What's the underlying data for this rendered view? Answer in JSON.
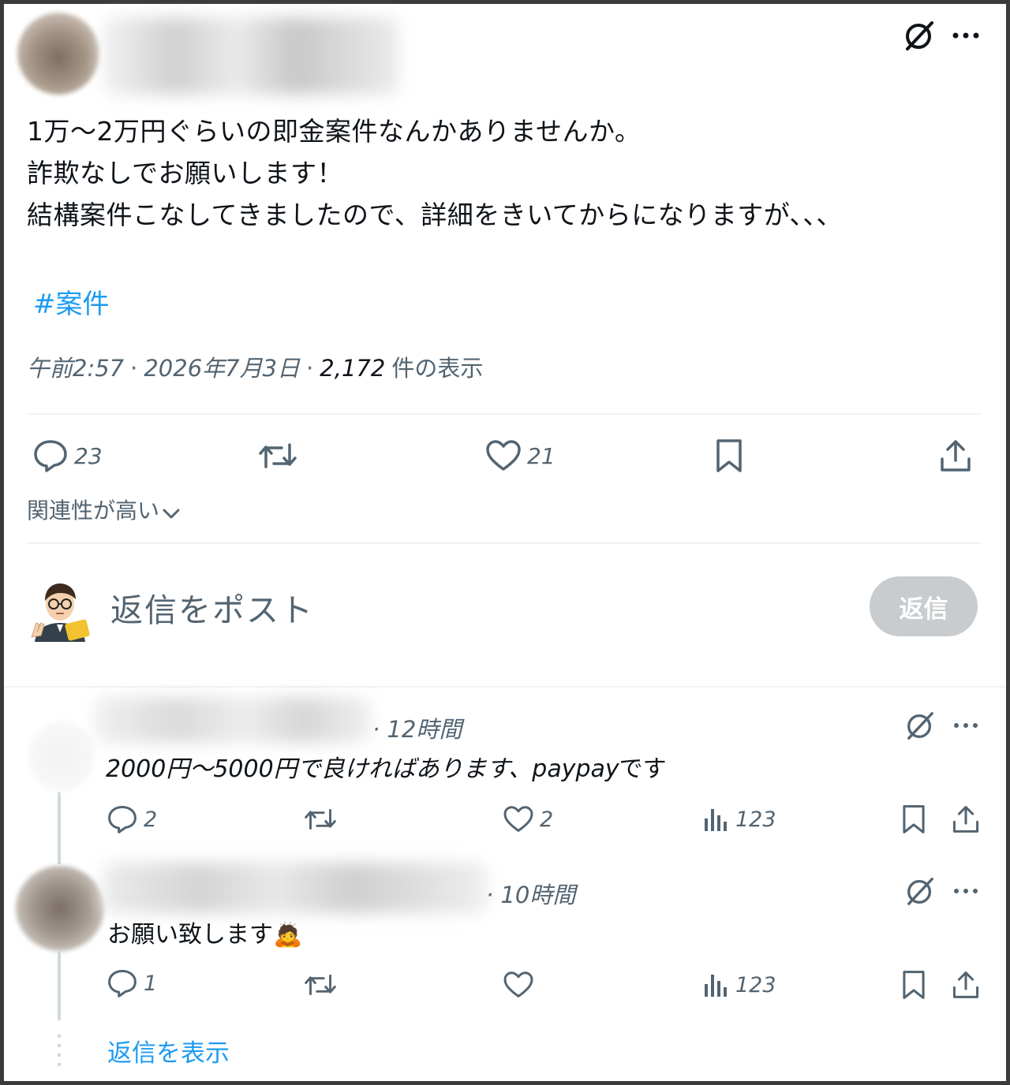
{
  "post": {
    "text_lines": [
      "1万～2万円ぐらいの即金案件なんかありませんか。",
      "詐欺なしでお願いします！",
      "結構案件こなしてきましたので、詳細をきいてからになりますが､､､"
    ],
    "hashtag": "#案件",
    "time": "午前2:57",
    "sep": "·",
    "date": "2026年7月3日",
    "views_count": "2,172",
    "views_label": "件の表示",
    "actions": {
      "replies": "23",
      "likes": "21"
    }
  },
  "sort": {
    "label": "関連性が高い"
  },
  "composer": {
    "placeholder": "返信をポスト",
    "button_label": "返信"
  },
  "replies": [
    {
      "time": "· 12時間",
      "text_a": "2000円～5000円で良ければあります、",
      "text_b": "paypay",
      "text_c": "です",
      "replies": "2",
      "likes": "2",
      "views": "123"
    },
    {
      "time": "· 10時間",
      "text": "お願い致します",
      "emoji": "🙇",
      "replies": "1",
      "views": "123"
    }
  ],
  "show_replies": "返信を表示",
  "icons": [
    "grok-icon",
    "more-icon",
    "reply-icon",
    "repost-icon",
    "like-icon",
    "bookmark-icon",
    "share-icon",
    "views-icon",
    "chevron-down-icon"
  ],
  "colors": {
    "accent": "#1d9bf0",
    "text": "#0f1419",
    "muted": "#536471",
    "divider": "#eff3f4",
    "button_disabled": "#c9ccce"
  }
}
